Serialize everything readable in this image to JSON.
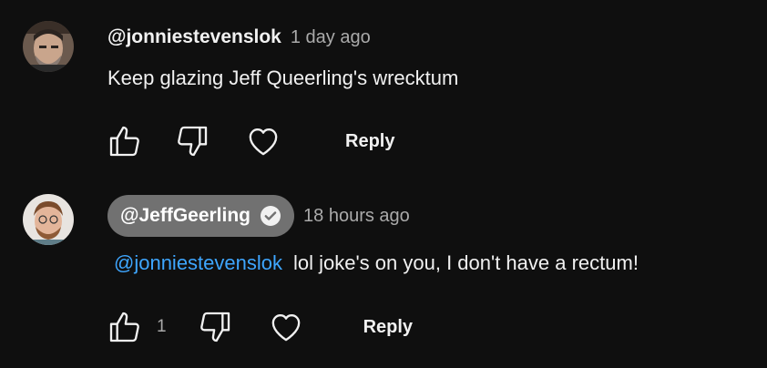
{
  "comment": {
    "author": "@jonniestevenslok",
    "timestamp": "1 day ago",
    "text": "Keep glazing Jeff Queerling's wrecktum",
    "reply_label": "Reply",
    "like_count": ""
  },
  "reply": {
    "author": "@JeffGeerling",
    "verified": true,
    "timestamp": "18 hours ago",
    "mention": "@jonniestevenslok",
    "text": "lol joke's on you, I don't have a rectum!",
    "like_count": "1",
    "reply_label": "Reply"
  },
  "colors": {
    "background": "#0f0f0f",
    "text": "#f1f1f1",
    "muted": "#aaaaaa",
    "mention": "#3ea6ff",
    "author_pill": "#717171"
  },
  "icons": [
    "like-icon",
    "dislike-icon",
    "heart-icon",
    "verified-check-icon"
  ]
}
